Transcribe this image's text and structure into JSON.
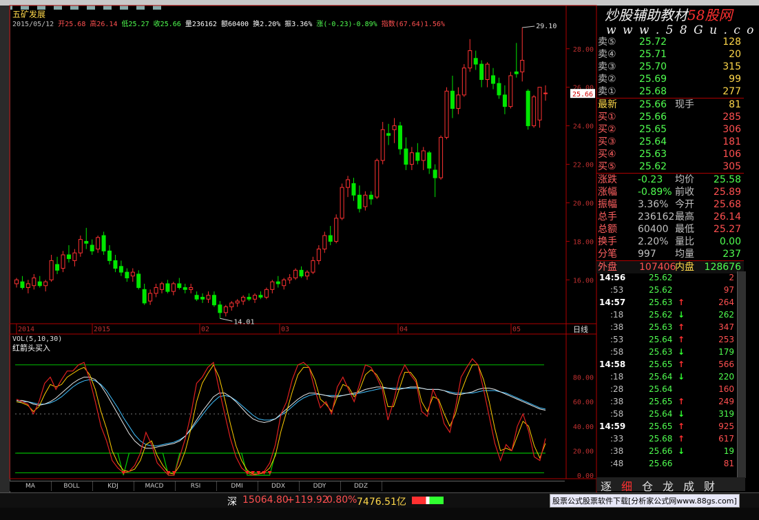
{
  "header": {
    "stock_name": "五矿发展",
    "date": "2015/05/12",
    "open_label": "开",
    "open": "25.68",
    "high_label": "高",
    "high": "26.14",
    "low_label": "低",
    "low": "25.27",
    "close_label": "收",
    "close": "25.66",
    "vol_label": "量",
    "vol": "236162",
    "amount_label": "额",
    "amount": "60400",
    "turnover_label": "换",
    "turnover": "2.20%",
    "amplitude_label": "振",
    "amplitude": "3.36%",
    "change_label": "涨",
    "change": "(-0.23)-0.89%",
    "index_label": "指数",
    "index": "(67.64)1.56%"
  },
  "watermark": {
    "line1a": "炒股辅助教材",
    "line1b": "58股网",
    "line2": "w w w . 5 8 G u . c o m"
  },
  "price_axis": {
    "labels": [
      "28.00",
      "26.00",
      "24.00",
      "22.00",
      "20.00",
      "18.00",
      "16.00"
    ],
    "current": "25.66",
    "marker_high": "29.10",
    "marker_low": "14.01"
  },
  "x_axis": {
    "labels": [
      "2014",
      "2015",
      "02",
      "03",
      "04",
      "05"
    ],
    "period": "日线"
  },
  "sub_chart": {
    "vol_label": "VOL(5,10,30)",
    "indicator_name": "红箭头买入",
    "axis": [
      "80.00",
      "60.00",
      "40.00",
      "20.00",
      "0.00"
    ]
  },
  "bottom_tabs": [
    "MA",
    "BOLL",
    "KDJ",
    "MACD",
    "RSI",
    "DMI",
    "DDX",
    "DDY",
    "DDZ"
  ],
  "quote": {
    "sell": [
      {
        "label": "卖⑤",
        "price": "25.72",
        "vol": "128"
      },
      {
        "label": "卖④",
        "price": "25.71",
        "vol": "20"
      },
      {
        "label": "卖③",
        "price": "25.70",
        "vol": "315"
      },
      {
        "label": "卖②",
        "price": "25.69",
        "vol": "99"
      },
      {
        "label": "卖①",
        "price": "25.68",
        "vol": "277"
      }
    ],
    "latest_label": "最新",
    "latest": "25.66",
    "now_hand_label": "现手",
    "now_hand": "81",
    "buy": [
      {
        "label": "买①",
        "price": "25.66",
        "vol": "285"
      },
      {
        "label": "买②",
        "price": "25.65",
        "vol": "306"
      },
      {
        "label": "买③",
        "price": "25.64",
        "vol": "181"
      },
      {
        "label": "买④",
        "price": "25.63",
        "vol": "106"
      },
      {
        "label": "买⑤",
        "price": "25.62",
        "vol": "305"
      }
    ],
    "stats": [
      {
        "l1": "涨跌",
        "v1": "-0.23",
        "l2": "均价",
        "v2": "25.58"
      },
      {
        "l1": "涨幅",
        "v1": "-0.89%",
        "l2": "前收",
        "v2": "25.89"
      },
      {
        "l1": "振幅",
        "v1": "3.36%",
        "l2": "今开",
        "v2": "25.68"
      },
      {
        "l1": "总手",
        "v1": "236162",
        "l2": "最高",
        "v2": "26.14"
      },
      {
        "l1": "总额",
        "v1": "60400",
        "l2": "最低",
        "v2": "25.27"
      },
      {
        "l1": "换手",
        "v1": "2.20%",
        "l2": "量比",
        "v2": "0.00"
      },
      {
        "l1": "分笔",
        "v1": "997",
        "l2": "均量",
        "v2": "237"
      }
    ],
    "outer_label": "外盘",
    "outer": "107406",
    "inner_label": "内盘",
    "inner": "128676"
  },
  "ticks": [
    {
      "time": "14:56",
      "price": "25.62",
      "dir": "",
      "vol": "2"
    },
    {
      "time": ":53",
      "price": "25.62",
      "dir": "",
      "vol": "97"
    },
    {
      "time": "14:57",
      "price": "25.63",
      "dir": "↑",
      "vol": "264"
    },
    {
      "time": ":18",
      "price": "25.62",
      "dir": "↓",
      "vol": "262"
    },
    {
      "time": ":38",
      "price": "25.63",
      "dir": "↑",
      "vol": "347"
    },
    {
      "time": ":53",
      "price": "25.64",
      "dir": "↑",
      "vol": "253"
    },
    {
      "time": ":58",
      "price": "25.63",
      "dir": "↓",
      "vol": "179"
    },
    {
      "time": "14:58",
      "price": "25.65",
      "dir": "↑",
      "vol": "566"
    },
    {
      "time": ":18",
      "price": "25.64",
      "dir": "↓",
      "vol": "220"
    },
    {
      "time": ":28",
      "price": "25.64",
      "dir": "",
      "vol": "160"
    },
    {
      "time": ":38",
      "price": "25.65",
      "dir": "↑",
      "vol": "249"
    },
    {
      "time": ":58",
      "price": "25.64",
      "dir": "↓",
      "vol": "319"
    },
    {
      "time": "14:59",
      "price": "25.65",
      "dir": "↑",
      "vol": "925"
    },
    {
      "time": ":33",
      "price": "25.68",
      "dir": "↑",
      "vol": "617"
    },
    {
      "time": ":38",
      "price": "25.66",
      "dir": "↓",
      "vol": "19"
    },
    {
      "time": ":48",
      "price": "25.66",
      "dir": "",
      "vol": "81"
    }
  ],
  "right_tabs": [
    "逐",
    "细",
    "仓",
    "龙",
    "成",
    "财"
  ],
  "status": {
    "market": "深",
    "index": "15064.80",
    "change": "+119.92",
    "pct": "0.80%",
    "amount": "7476.51亿",
    "ad_link": "股票公式股票软件下载[分析家公式网www.88gs.com]"
  },
  "chart_data": {
    "type": "candlestick",
    "price_range": [
      14.01,
      29.1
    ],
    "candles": [
      [
        15.8,
        16.1,
        15.6,
        16.0
      ],
      [
        15.9,
        16.2,
        15.5,
        15.6
      ],
      [
        15.6,
        16.0,
        15.3,
        15.8
      ],
      [
        15.7,
        16.3,
        15.5,
        16.1
      ],
      [
        15.9,
        16.2,
        15.6,
        15.7
      ],
      [
        15.7,
        16.0,
        15.4,
        15.9
      ],
      [
        16.0,
        17.3,
        15.9,
        17.0
      ],
      [
        16.8,
        17.2,
        16.3,
        16.5
      ],
      [
        16.6,
        17.5,
        16.4,
        17.3
      ],
      [
        17.3,
        17.8,
        16.9,
        17.1
      ],
      [
        17.0,
        17.6,
        16.7,
        17.4
      ],
      [
        17.4,
        18.3,
        17.2,
        18.1
      ],
      [
        18.0,
        18.7,
        17.6,
        17.9
      ],
      [
        17.8,
        18.1,
        17.3,
        17.5
      ],
      [
        17.6,
        18.3,
        17.4,
        18.2
      ],
      [
        18.3,
        18.5,
        17.3,
        17.5
      ],
      [
        17.5,
        17.8,
        16.8,
        17.0
      ],
      [
        17.0,
        17.3,
        16.4,
        16.6
      ],
      [
        16.7,
        17.0,
        16.2,
        16.4
      ],
      [
        16.4,
        16.6,
        15.9,
        16.1
      ],
      [
        16.2,
        16.6,
        15.9,
        16.4
      ],
      [
        16.3,
        16.5,
        15.5,
        15.6
      ],
      [
        15.5,
        15.8,
        14.7,
        14.8
      ],
      [
        14.9,
        15.5,
        14.7,
        15.3
      ],
      [
        15.3,
        15.8,
        15.1,
        15.6
      ],
      [
        15.5,
        15.9,
        15.3,
        15.8
      ],
      [
        15.8,
        16.0,
        15.3,
        15.4
      ],
      [
        15.4,
        15.9,
        15.2,
        15.8
      ],
      [
        15.8,
        16.1,
        15.5,
        15.6
      ],
      [
        15.6,
        15.8,
        15.3,
        15.5
      ],
      [
        15.5,
        15.8,
        15.3,
        15.6
      ],
      [
        15.2,
        15.4,
        14.9,
        15.0
      ],
      [
        15.1,
        15.3,
        14.8,
        15.0
      ],
      [
        15.0,
        15.4,
        14.8,
        15.2
      ],
      [
        15.2,
        15.4,
        14.6,
        14.7
      ],
      [
        14.7,
        14.9,
        14.0,
        14.3
      ],
      [
        14.3,
        14.7,
        14.1,
        14.6
      ],
      [
        14.6,
        14.9,
        14.4,
        14.8
      ],
      [
        14.8,
        15.0,
        14.6,
        14.9
      ],
      [
        14.9,
        15.2,
        14.7,
        15.1
      ],
      [
        15.1,
        15.3,
        14.9,
        15.0
      ],
      [
        15.0,
        15.3,
        14.8,
        15.2
      ],
      [
        15.2,
        15.4,
        15.0,
        15.1
      ],
      [
        15.1,
        15.6,
        15.0,
        15.5
      ],
      [
        15.5,
        16.0,
        15.3,
        15.9
      ],
      [
        15.9,
        16.2,
        15.6,
        15.8
      ],
      [
        15.7,
        16.1,
        15.5,
        16.0
      ],
      [
        16.0,
        16.3,
        15.8,
        16.1
      ],
      [
        16.1,
        16.6,
        16.0,
        16.5
      ],
      [
        16.5,
        16.7,
        16.1,
        16.2
      ],
      [
        16.2,
        16.5,
        16.0,
        16.4
      ],
      [
        16.4,
        17.2,
        16.3,
        17.0
      ],
      [
        17.0,
        17.8,
        16.8,
        17.6
      ],
      [
        17.6,
        18.5,
        17.4,
        18.3
      ],
      [
        18.3,
        18.8,
        17.8,
        18.0
      ],
      [
        18.0,
        19.4,
        17.9,
        19.2
      ],
      [
        19.2,
        21.0,
        19.1,
        20.8
      ],
      [
        20.8,
        21.4,
        20.3,
        21.2
      ],
      [
        21.0,
        21.3,
        20.1,
        20.4
      ],
      [
        20.4,
        20.9,
        19.5,
        19.7
      ],
      [
        19.8,
        20.6,
        19.6,
        20.4
      ],
      [
        20.4,
        20.6,
        19.9,
        20.2
      ],
      [
        20.3,
        22.3,
        20.2,
        22.2
      ],
      [
        22.2,
        24.2,
        22.0,
        23.8
      ],
      [
        23.6,
        24.1,
        23.0,
        23.5
      ],
      [
        23.8,
        24.4,
        23.1,
        24.0
      ],
      [
        24.0,
        24.2,
        22.5,
        22.8
      ],
      [
        22.8,
        23.4,
        21.7,
        22.0
      ],
      [
        22.0,
        22.9,
        21.7,
        22.6
      ],
      [
        22.6,
        23.1,
        22.0,
        22.2
      ],
      [
        22.2,
        22.9,
        21.7,
        22.7
      ],
      [
        22.6,
        22.7,
        21.5,
        21.8
      ],
      [
        21.7,
        22.0,
        20.3,
        21.3
      ],
      [
        21.3,
        23.5,
        21.2,
        23.4
      ],
      [
        23.4,
        26.0,
        23.3,
        25.8
      ],
      [
        25.8,
        26.6,
        24.4,
        24.9
      ],
      [
        24.9,
        26.0,
        24.6,
        25.6
      ],
      [
        25.6,
        27.2,
        25.5,
        27.0
      ],
      [
        27.0,
        28.5,
        26.8,
        27.9
      ],
      [
        27.5,
        27.9,
        26.9,
        27.2
      ],
      [
        27.2,
        27.4,
        26.0,
        26.4
      ],
      [
        26.4,
        27.3,
        26.0,
        27.2
      ],
      [
        26.6,
        27.0,
        25.9,
        26.2
      ],
      [
        26.2,
        26.5,
        25.4,
        25.6
      ],
      [
        25.6,
        26.1,
        24.6,
        25.0
      ],
      [
        25.0,
        26.8,
        24.9,
        26.6
      ],
      [
        26.8,
        28.3,
        26.5,
        26.7
      ],
      [
        26.8,
        29.1,
        26.3,
        27.4
      ],
      [
        25.8,
        25.9,
        23.8,
        24.0
      ],
      [
        24.0,
        25.6,
        23.9,
        25.5
      ],
      [
        24.3,
        26.0,
        23.9,
        26.0
      ],
      [
        25.7,
        26.1,
        25.3,
        25.7
      ]
    ],
    "sub_indicator": {
      "ylim": [
        0,
        100
      ],
      "k": [
        62,
        60,
        58,
        50,
        60,
        75,
        80,
        70,
        78,
        85,
        85,
        90,
        92,
        78,
        60,
        40,
        28,
        12,
        6,
        2,
        3,
        8,
        18,
        35,
        25,
        10,
        5,
        0,
        0,
        15,
        30,
        50,
        75,
        80,
        88,
        92,
        70,
        50,
        30,
        15,
        6,
        2,
        0,
        1,
        3,
        10,
        25,
        50,
        60,
        78,
        90,
        92,
        88,
        70,
        55,
        60,
        50,
        72,
        80,
        70,
        60,
        75,
        90,
        88,
        80,
        70,
        45,
        60,
        80,
        90,
        82,
        76,
        52,
        48,
        70,
        60,
        42,
        35,
        55,
        80,
        88,
        95,
        90,
        70,
        48,
        26,
        12,
        25,
        20,
        40,
        50,
        36,
        15,
        12,
        30
      ],
      "d": [
        60,
        59,
        57,
        52,
        56,
        66,
        74,
        72,
        74,
        80,
        83,
        86,
        88,
        82,
        70,
        52,
        38,
        20,
        10,
        4,
        3,
        5,
        12,
        25,
        28,
        16,
        8,
        2,
        1,
        8,
        20,
        38,
        60,
        75,
        83,
        90,
        80,
        62,
        42,
        24,
        12,
        4,
        1,
        1,
        2,
        6,
        16,
        36,
        52,
        68,
        82,
        88,
        88,
        78,
        62,
        58,
        52,
        64,
        74,
        72,
        64,
        70,
        82,
        86,
        82,
        74,
        56,
        56,
        70,
        84,
        84,
        78,
        60,
        52,
        64,
        62,
        50,
        40,
        50,
        68,
        80,
        90,
        90,
        78,
        60,
        38,
        20,
        22,
        20,
        32,
        44,
        40,
        24,
        14,
        26
      ],
      "ma": [
        61,
        61,
        60,
        58,
        57,
        58,
        60,
        63,
        67,
        71,
        75,
        78,
        80,
        80,
        78,
        73,
        66,
        58,
        50,
        42,
        34,
        28,
        24,
        22,
        22,
        23,
        24,
        25,
        26,
        28,
        32,
        38,
        45,
        52,
        58,
        64,
        67,
        67,
        64,
        60,
        55,
        50,
        46,
        44,
        43,
        44,
        46,
        50,
        54,
        58,
        62,
        65,
        67,
        67,
        66,
        65,
        64,
        64,
        65,
        66,
        67,
        68,
        70,
        71,
        72,
        72,
        71,
        70,
        70,
        71,
        72,
        72,
        71,
        70,
        70,
        70,
        69,
        67,
        66,
        66,
        67,
        68,
        70,
        71,
        71,
        70,
        68,
        66,
        64,
        62,
        60,
        58,
        56,
        54,
        53
      ],
      "ma2": [
        60,
        60,
        60,
        59,
        58,
        58,
        59,
        61,
        64,
        68,
        72,
        75,
        77,
        78,
        77,
        74,
        69,
        62,
        55,
        47,
        40,
        33,
        28,
        25,
        24,
        24,
        25,
        26,
        27,
        29,
        32,
        37,
        43,
        49,
        55,
        60,
        64,
        65,
        64,
        61,
        57,
        53,
        49,
        46,
        45,
        45,
        46,
        49,
        52,
        56,
        60,
        63,
        65,
        66,
        66,
        65,
        65,
        65,
        65,
        66,
        66,
        67,
        68,
        69,
        70,
        71,
        71,
        71,
        71,
        71,
        71,
        71,
        71,
        70,
        70,
        70,
        69,
        68,
        67,
        67,
        67,
        67,
        68,
        69,
        69,
        69,
        68,
        67,
        65,
        63,
        61,
        59,
        57,
        55,
        54
      ],
      "buy_line": [
        18,
        18,
        18,
        18,
        18,
        18,
        18,
        18,
        18,
        18,
        18,
        18,
        18,
        18,
        18,
        18,
        18,
        18,
        18,
        0,
        18,
        18,
        18,
        18,
        18,
        18,
        18,
        0,
        0,
        18,
        18,
        18,
        18,
        18,
        18,
        18,
        18,
        18,
        18,
        18,
        18,
        0,
        0,
        0,
        0,
        0,
        18,
        18,
        18,
        18,
        18,
        18,
        18,
        18,
        18,
        18,
        18,
        18,
        18,
        18,
        18,
        18,
        18,
        18,
        18,
        18,
        18,
        18,
        18,
        18,
        18,
        18,
        18,
        18,
        18,
        18,
        18,
        18,
        18,
        18,
        18,
        18,
        18,
        18,
        18,
        18,
        18,
        18,
        18,
        18,
        18,
        18,
        18,
        18,
        18
      ],
      "levels": [
        90,
        50,
        18,
        2
      ]
    }
  }
}
